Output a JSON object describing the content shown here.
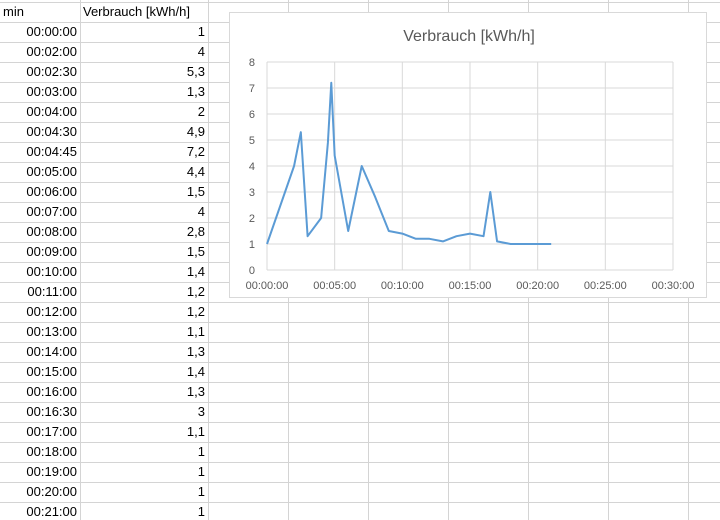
{
  "sheet": {
    "headers": {
      "col_a": "min",
      "col_b": "Verbrauch [kWh/h]"
    },
    "rows": [
      {
        "min": "00:00:00",
        "value": "1"
      },
      {
        "min": "00:02:00",
        "value": "4"
      },
      {
        "min": "00:02:30",
        "value": "5,3"
      },
      {
        "min": "00:03:00",
        "value": "1,3"
      },
      {
        "min": "00:04:00",
        "value": "2"
      },
      {
        "min": "00:04:30",
        "value": "4,9"
      },
      {
        "min": "00:04:45",
        "value": "7,2"
      },
      {
        "min": "00:05:00",
        "value": "4,4"
      },
      {
        "min": "00:06:00",
        "value": "1,5"
      },
      {
        "min": "00:07:00",
        "value": "4"
      },
      {
        "min": "00:08:00",
        "value": "2,8"
      },
      {
        "min": "00:09:00",
        "value": "1,5"
      },
      {
        "min": "00:10:00",
        "value": "1,4"
      },
      {
        "min": "00:11:00",
        "value": "1,2"
      },
      {
        "min": "00:12:00",
        "value": "1,2"
      },
      {
        "min": "00:13:00",
        "value": "1,1"
      },
      {
        "min": "00:14:00",
        "value": "1,3"
      },
      {
        "min": "00:15:00",
        "value": "1,4"
      },
      {
        "min": "00:16:00",
        "value": "1,3"
      },
      {
        "min": "00:16:30",
        "value": "3"
      },
      {
        "min": "00:17:00",
        "value": "1,1"
      },
      {
        "min": "00:18:00",
        "value": "1"
      },
      {
        "min": "00:19:00",
        "value": "1"
      },
      {
        "min": "00:20:00",
        "value": "1"
      },
      {
        "min": "00:21:00",
        "value": "1"
      }
    ]
  },
  "chart_data": {
    "type": "line",
    "title": "Verbrauch [kWh/h]",
    "xlabel": "",
    "ylabel": "",
    "x": [
      "00:00:00",
      "00:02:00",
      "00:02:30",
      "00:03:00",
      "00:04:00",
      "00:04:30",
      "00:04:45",
      "00:05:00",
      "00:06:00",
      "00:07:00",
      "00:08:00",
      "00:09:00",
      "00:10:00",
      "00:11:00",
      "00:12:00",
      "00:13:00",
      "00:14:00",
      "00:15:00",
      "00:16:00",
      "00:16:30",
      "00:17:00",
      "00:18:00",
      "00:19:00",
      "00:20:00",
      "00:21:00"
    ],
    "series": [
      {
        "values": [
          1,
          4,
          5.3,
          1.3,
          2,
          4.9,
          7.2,
          4.4,
          1.5,
          4,
          2.8,
          1.5,
          1.4,
          1.2,
          1.2,
          1.1,
          1.3,
          1.4,
          1.3,
          3,
          1.1,
          1,
          1,
          1,
          1
        ],
        "color": "#5b9bd5"
      }
    ],
    "xlim": [
      "00:00:00",
      "00:30:00"
    ],
    "ylim": [
      0,
      8
    ],
    "x_tick_labels": [
      "00:00:00",
      "00:05:00",
      "00:10:00",
      "00:15:00",
      "00:20:00",
      "00:25:00",
      "00:30:00"
    ],
    "y_tick_labels": [
      "0",
      "1",
      "2",
      "3",
      "4",
      "5",
      "6",
      "7",
      "8"
    ],
    "grid": true,
    "legend": "none"
  }
}
